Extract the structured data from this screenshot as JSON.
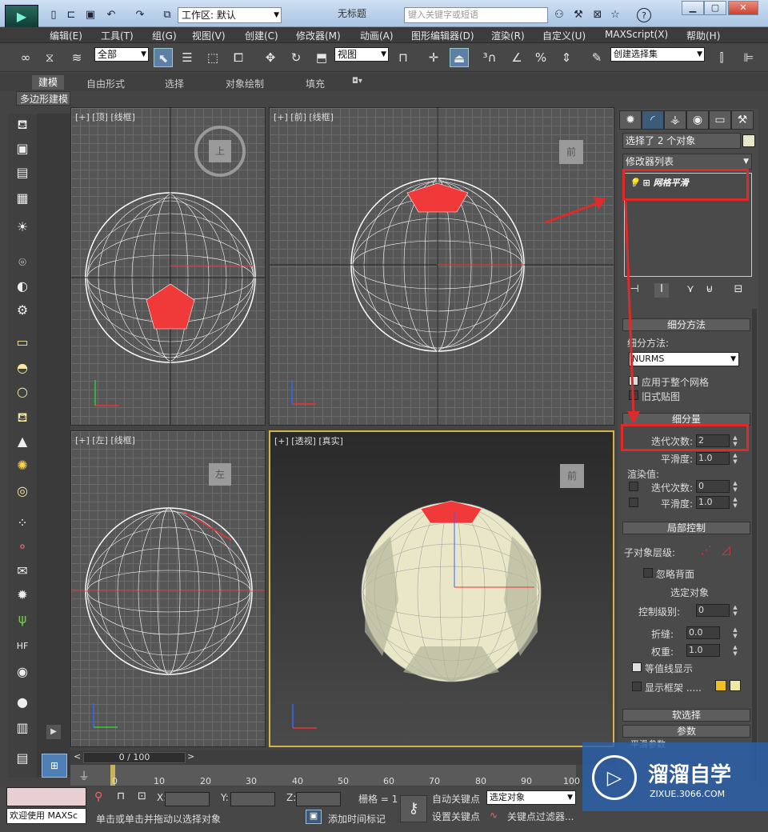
{
  "app": {
    "workspace": "工作区: 默认",
    "title": "无标题",
    "search_placeholder": "键入关键字或短语"
  },
  "menus": [
    "编辑(E)",
    "工具(T)",
    "组(G)",
    "视图(V)",
    "创建(C)",
    "修改器(M)",
    "动画(A)",
    "图形编辑器(D)",
    "渲染(R)",
    "自定义(U)",
    "MAXScript(X)",
    "帮助(H)"
  ],
  "toolbar": {
    "filter": "全部",
    "refcoord": "视图",
    "selset": "创建选择集"
  },
  "ribbon": {
    "tabs": [
      "建模",
      "自由形式",
      "选择",
      "对象绘制",
      "填充"
    ],
    "sub": "多边形建模"
  },
  "viewports": {
    "top": "[+] [顶] [线框]",
    "front": "[+] [前] [线框]",
    "left": "[+] [左] [线框]",
    "persp": "[+] [透视] [真实]"
  },
  "viewcube": {
    "top": "上",
    "front": "前",
    "left": "左",
    "persp": "前"
  },
  "cmd": {
    "selected": "选择了 2 个对象",
    "modlist": "修改器列表",
    "modifier": "网格平滑",
    "subdiv_method_title": "细分方法",
    "subdiv_method_label": "细分方法:",
    "subdiv_method_value": "NURMS",
    "apply_whole": "应用于整个网格",
    "old_map": "旧式贴图",
    "subdiv_title": "细分量",
    "iterations_label": "迭代次数:",
    "iterations": "2",
    "smooth_label": "平滑度:",
    "smooth": "1.0",
    "render_label": "渲染值:",
    "r_iter_label": "迭代次数:",
    "r_iter": "0",
    "r_smooth_label": "平滑度:",
    "r_smooth": "1.0",
    "local_title": "局部控制",
    "sublevel_label": "子对象层级:",
    "ignore_back": "忽略背面",
    "selected_obj": "选定对象",
    "ctrl_level_label": "控制级别:",
    "ctrl_level": "0",
    "crease_label": "折缝:",
    "crease": "0.0",
    "weight_label": "权重:",
    "weight": "1.0",
    "isoline": "等值线显示",
    "show_cage": "显示框架 .....",
    "soft_title": "软选择",
    "params_title": "参数",
    "smooth_params": "平滑参数"
  },
  "timeline": {
    "range": "0 / 100",
    "ticks": [
      "0",
      "10",
      "20",
      "30",
      "40",
      "50",
      "60",
      "70",
      "80",
      "90",
      "100"
    ]
  },
  "bottom": {
    "welcome": "欢迎使用 MAXSc",
    "prompt": "单击或单击并拖动以选择对象",
    "add_time": "添加时间标记",
    "x": "X:",
    "y": "Y:",
    "z": "Z:",
    "grid": "栅格 = 1",
    "autokey": "自动关键点",
    "setkey": "设置关键点",
    "keymode": "选定对象",
    "keyfilter": "关键点过滤器..."
  },
  "watermark": {
    "title": "溜溜自学",
    "url": "ZIXUE.3066.COM"
  },
  "colors": {
    "accent": "#e02a2a",
    "viewport_active": "#d3b44a",
    "selection_red": "#f03a3a"
  }
}
